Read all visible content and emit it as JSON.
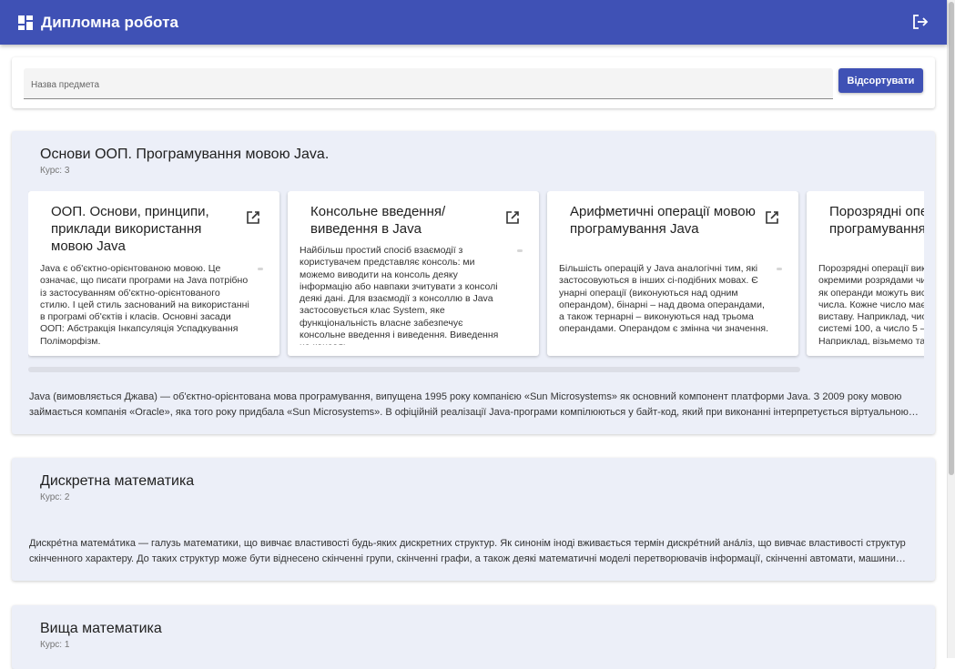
{
  "app": {
    "title": "Дипломна робота"
  },
  "search": {
    "placeholder": "Назва предмета",
    "sort_label": "Відсортувати"
  },
  "subjects": [
    {
      "title": "Основи ООП. Програмування мовою Java.",
      "course": "Курс: 3",
      "description": "Java (вимовляється Джава) — об'єктно-орієнтована мова програмування, випущена 1995 року компанією «Sun Microsystems» як основний компонент платформи Java. З 2009 року мовою займається компанія «Oracle», яка того року придбала «Sun Microsystems». В офіційній реалізації Java-програми компілюються у байт-код, який при виконанні інтерпретується віртуальною машиною.",
      "topics": [
        {
          "title": "ООП. Основи, принципи, приклади використання мовою Java",
          "text": "Java є об'єктно-орієнтованою мовою. Це означає, що писати програми на Java потрібно із застосуванням об'єктно-орієнтованого стилю. І цей стиль заснований на використанні в програмі об'єктів і класів. Основні засади ООП: Абстракція Інкапсуляція Успадкування Поліморфізм."
        },
        {
          "title": "Консольне введення/виведення в Java",
          "text": "Найбільш простий спосіб взаємодії з користувачем представляє консоль: ми можемо виводити на консоль деяку інформацію або навпаки зчитувати з консолі деякі дані. Для взаємодії з консоллю в Java застосовується клас System, яке функціональність власне забезпечує консольне введення і виведення. Виведення на консоль."
        },
        {
          "title": "Арифметичні операції мовою програмування Java",
          "text": "Більшість операцій у Java аналогічні тим, які застосовуються в інших сі-подібних мовах. Є унарні операції (виконуються над одним операндом), бінарні – над двома операндами, а також тернарні – виконуються над трьома операндами. Операндом є змінна чи значення."
        },
        {
          "title": "Порозрядні операції мовою програмування Java",
          "text": "Порозрядні операції виконуються над окремими розрядами чисел. У даних операціях як операнди можуть виступати тільки цілі числа. Кожне число має певну двійкову виставу. Наприклад, число 4 у двійковій системі 100, а число 5 – 101 і так далі. Наприклад, візьмемо такі змінні."
        }
      ]
    },
    {
      "title": "Дискретна математика",
      "course": "Курс: 2",
      "description": "Дискре́тна матема́тика — галузь математики, що вивчає властивості будь-яких дискретних структур. Як синонім іноді вживається термін дискре́тний ана́ліз, що вивчає властивості структур скінченного характеру. До таких структур може бути віднесено скінченні групи, скінченні графи, а також деякі математичні моделі перетворювачів інформації, скінченні автомати, машини Тюрінга тощо."
    },
    {
      "title": "Вища математика",
      "course": "Курс: 1"
    }
  ]
}
